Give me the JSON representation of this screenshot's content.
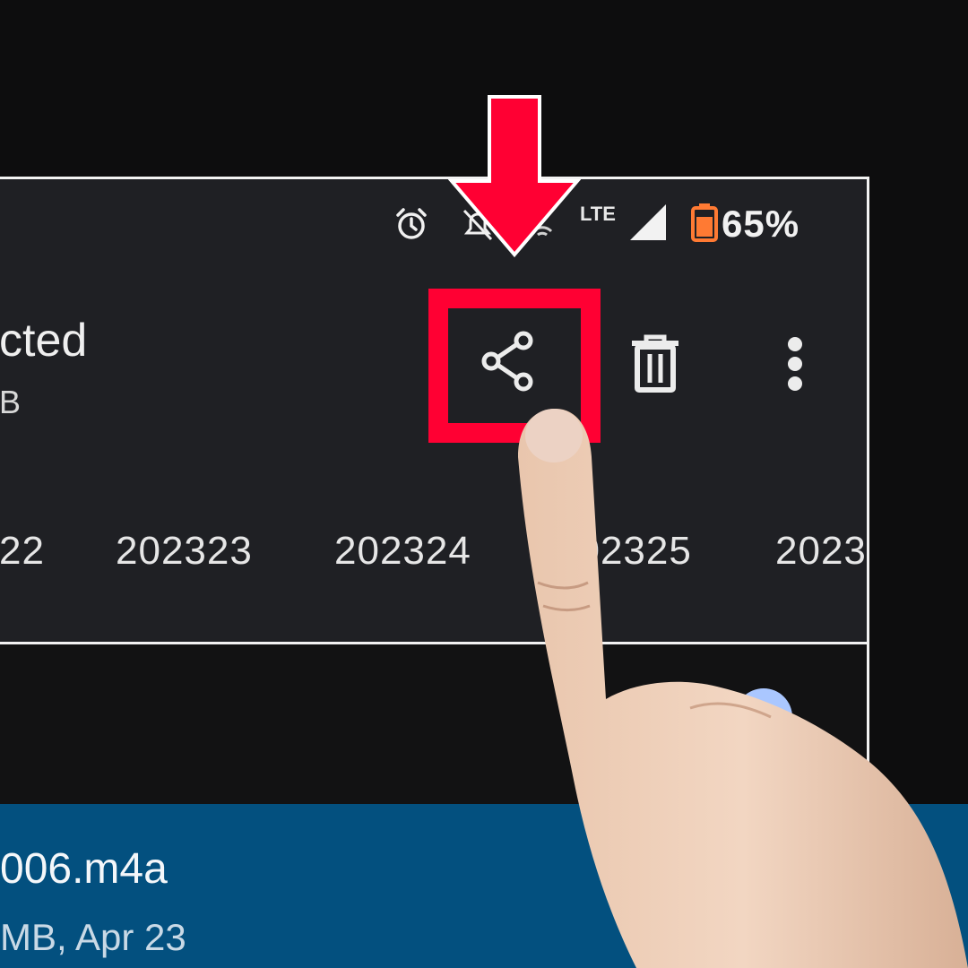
{
  "status_bar": {
    "icons": [
      "alarm-icon",
      "bell-off-icon",
      "hotspot-icon",
      "signal-icon"
    ],
    "lte_label": "LTE",
    "battery_text": "65%",
    "battery_color": "#ff7a33"
  },
  "header": {
    "selection_title": "cted",
    "selection_size": "B"
  },
  "actions": [
    {
      "name": "share-button",
      "icon": "share-icon"
    },
    {
      "name": "delete-button",
      "icon": "trash-icon"
    },
    {
      "name": "more-options-button",
      "icon": "more-vert-icon"
    }
  ],
  "folder_chips": [
    "22",
    "202323",
    "202324",
    "202325",
    "2023"
  ],
  "file": {
    "name": "006.m4a",
    "meta": "MB, Apr 23"
  },
  "overlay": {
    "highlight_color": "#ff0033",
    "arrow_color": "#ff0033"
  }
}
